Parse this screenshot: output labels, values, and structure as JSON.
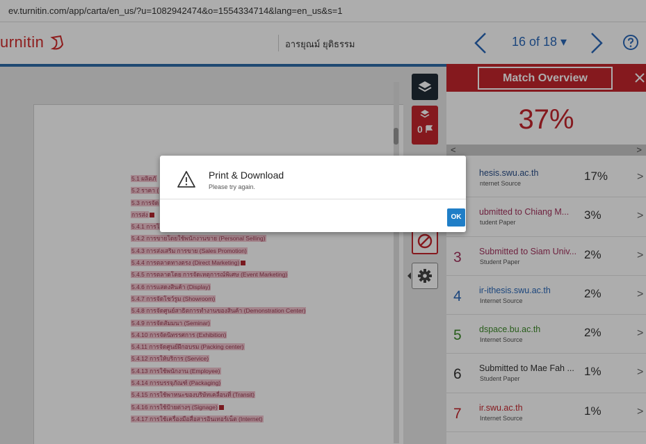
{
  "browser": {
    "url": "ev.turnitin.com/app/carta/en_us/?u=1082942474&o=1554334714&lang=en_us&s=1"
  },
  "header": {
    "logo_text": "urnitin",
    "author": "อารยุณม์ ยุติธรรม",
    "page_indicator": "16 of 18 ▾"
  },
  "toolbar": {
    "flag_count": "0"
  },
  "document": {
    "lines": [
      {
        "pre": "5.1 ผลิตภั",
        "hl": ""
      },
      {
        "pre": "5.2 ราคา (",
        "hl": ""
      },
      {
        "pre": "5.3 การจัด",
        "hl": ""
      },
      {
        "pre": "การส่ง",
        "hl": ""
      },
      {
        "pre": "5.4.1 การโ",
        "hl": ""
      },
      {
        "pre": "5.4.2 การขายโดยใช้พนักงานขาย (Personal Selling)",
        "hl": ""
      },
      {
        "pre": "5.4.3 การส่งเสริม",
        "hl": "การขาย (Sales Promotion)"
      },
      {
        "pre": "5.4.4 การตลาดทางตรง (Direct Marketing)",
        "hl": ""
      },
      {
        "pre": "5.4.5 การตลาดโดย",
        "hl": "การจัดเหตุการณ์พิเศษ (Event Marketing)"
      },
      {
        "pre": "5.4.6 การแสดงสินค้า (Display)",
        "hl": ""
      },
      {
        "pre": "5.4.7 การจัดโชว์รูม (Showroom)",
        "hl": ""
      },
      {
        "pre": "5.4.8 การจัดศูนย์สาธิตการทำงานของสินค้า (Demonstration Center)",
        "hl": ""
      },
      {
        "pre": "5.4.9 การจัดสัมมนา (Seminar)",
        "hl": ""
      },
      {
        "pre": "5.4.10 การจัดนิทรรศการ (Exhibition)",
        "hl": ""
      },
      {
        "pre": "5.4.11 การจัดศูนย์ฝึกอบรม (Packing center)",
        "hl": ""
      },
      {
        "pre": "5.4.12 การให้บริการ (Service)",
        "hl": ""
      },
      {
        "pre": "5.4.13 การใช้พนักงาน (Employee)",
        "hl": ""
      },
      {
        "pre": "5.4.14 การบรรจุภัณฑ์ (Packaging)",
        "hl": ""
      },
      {
        "pre": "5.4.15 การใช้พาหนะของบริษัทเคลื่อนที่ (Transit)",
        "hl": ""
      },
      {
        "pre": "5.4.16 การใช้ป้ายต่างๆ (Signage)",
        "hl": ""
      },
      {
        "pre": "5.4.17 การใช้เครื่องมือสื่อสารอินเทอร์เน็ต (Internet)",
        "hl": ""
      }
    ]
  },
  "panel": {
    "title": "Match Overview",
    "score": "37%",
    "matches": [
      {
        "num": "",
        "source": "hesis.swu.ac.th",
        "type": "nternet Source",
        "pct": "17%",
        "color": "#2a4f8a"
      },
      {
        "num": "",
        "source": "ubmitted to Chiang M...",
        "type": "tudent Paper",
        "pct": "3%",
        "color": "#a3325d"
      },
      {
        "num": "3",
        "source": "Submitted to Siam Univ...",
        "type": "Student Paper",
        "pct": "2%",
        "color": "#a3325d"
      },
      {
        "num": "4",
        "source": "ir-ithesis.swu.ac.th",
        "type": "Internet Source",
        "pct": "2%",
        "color": "#2a68b8"
      },
      {
        "num": "5",
        "source": "dspace.bu.ac.th",
        "type": "Internet Source",
        "pct": "2%",
        "color": "#3d8a2a"
      },
      {
        "num": "6",
        "source": "Submitted to Mae Fah ...",
        "type": "Student Paper",
        "pct": "1%",
        "color": "#333333"
      },
      {
        "num": "7",
        "source": "ir.swu.ac.th",
        "type": "Internet Source",
        "pct": "1%",
        "color": "#c5262d"
      }
    ]
  },
  "modal": {
    "title": "Print & Download",
    "message": "Please try again.",
    "ok_label": "OK"
  }
}
